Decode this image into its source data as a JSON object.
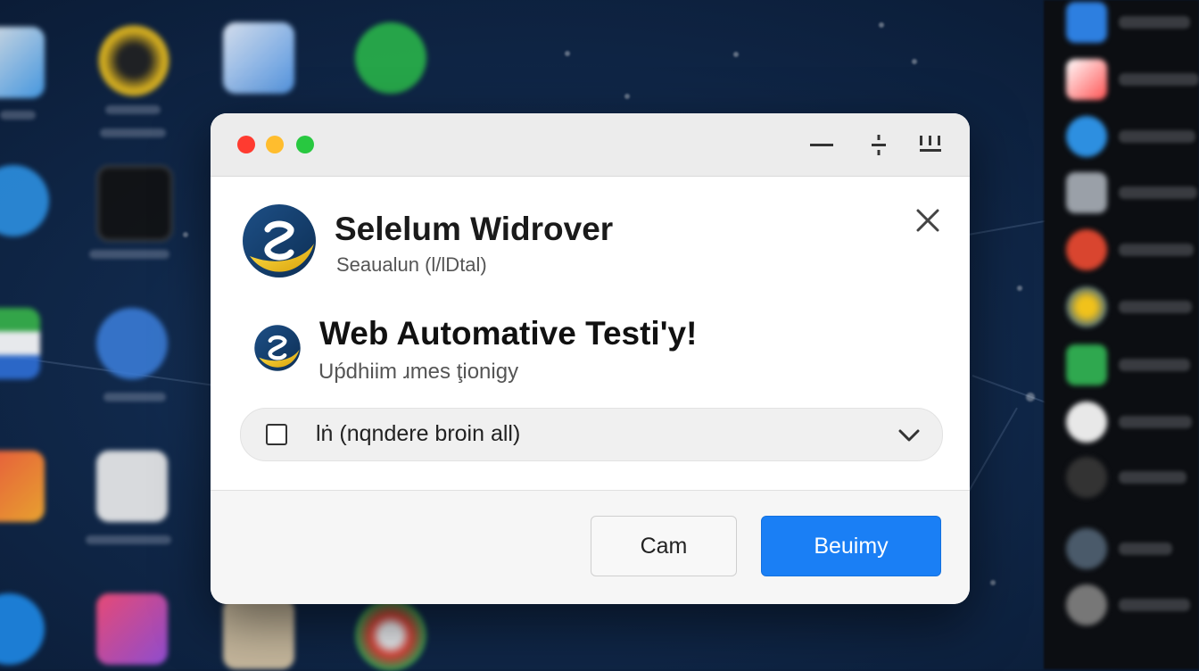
{
  "window": {
    "title_controls": [
      "minimize-icon",
      "split-view-icon",
      "grid-view-icon"
    ],
    "colors": {
      "accent": "#1a7ff5",
      "close_red": "#ff3b30",
      "minimize_yellow": "#ffbd2e",
      "zoom_green": "#28c840"
    }
  },
  "app": {
    "title": "Selelum Widrover",
    "subtitle": "Seaualun (l/lDtal)"
  },
  "feature": {
    "title": "Web Automative Testi'y!",
    "subtitle": "Uṕdhiim ɹmes ţioniɡy"
  },
  "option": {
    "label": "lṅ (nqndere broin all)",
    "checked": false,
    "icon": "chevron-down-icon"
  },
  "buttons": {
    "secondary_label": "Cam",
    "primary_label": "Beuimy"
  }
}
